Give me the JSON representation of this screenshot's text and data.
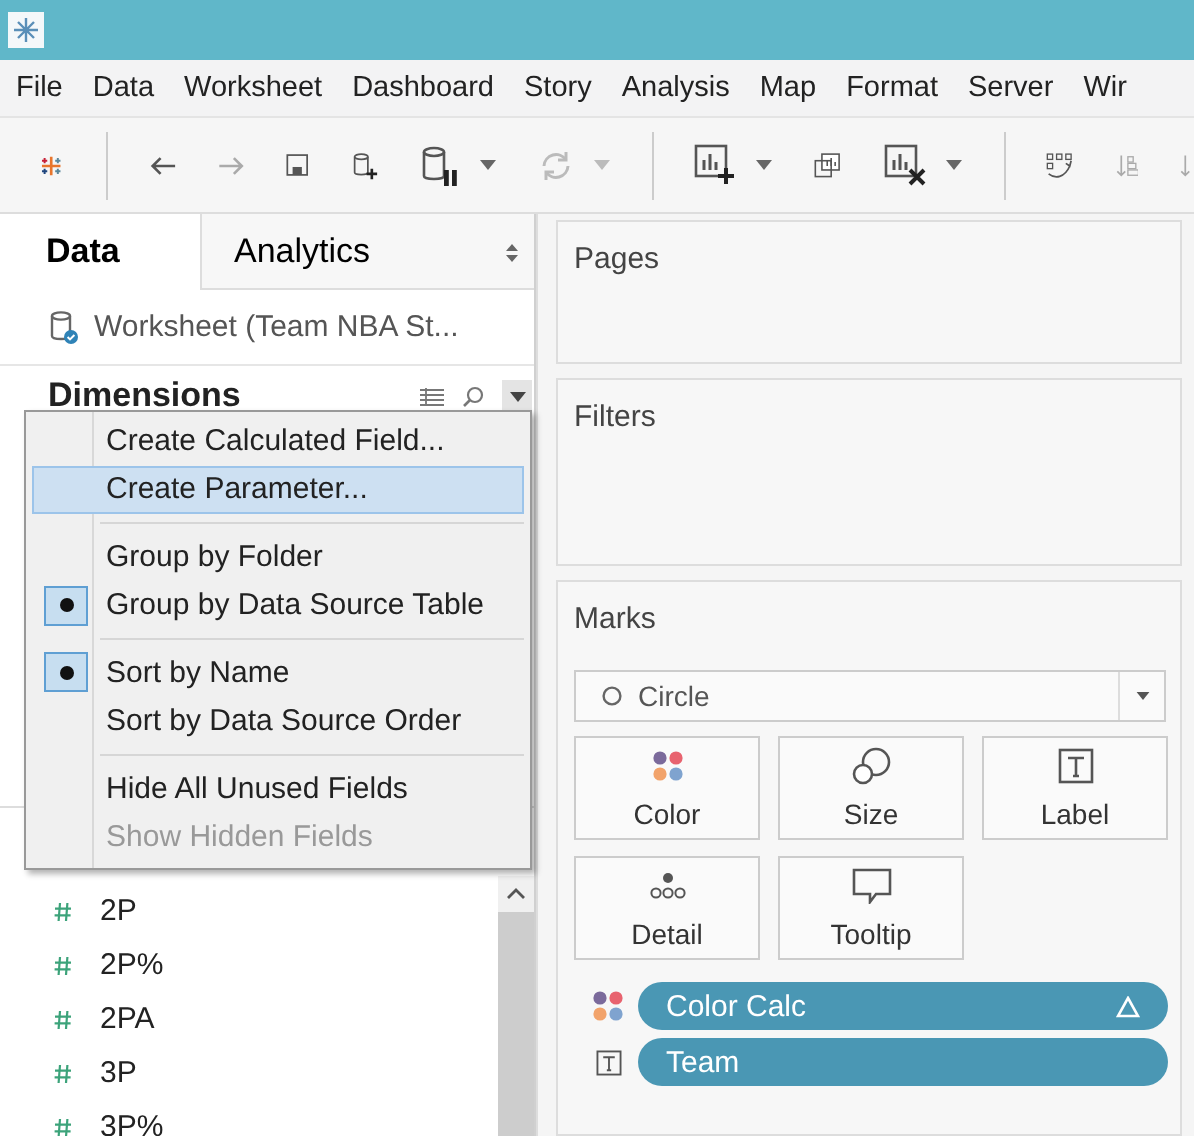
{
  "menubar": [
    "File",
    "Data",
    "Worksheet",
    "Dashboard",
    "Story",
    "Analysis",
    "Map",
    "Format",
    "Server",
    "Wir"
  ],
  "tabs": [
    {
      "label": "Data",
      "selected": true
    },
    {
      "label": "Analytics",
      "selected": false
    }
  ],
  "data_source": "Worksheet (Team NBA St...",
  "section_title": "Dimensions",
  "fields": [
    "2P",
    "2P%",
    "2PA",
    "3P",
    "3P%"
  ],
  "context_menu": [
    [
      {
        "label": "Create Calculated Field...",
        "selected": false,
        "checked": false,
        "disabled": false
      },
      {
        "label": "Create Parameter...",
        "selected": true,
        "checked": false,
        "disabled": false
      }
    ],
    [
      {
        "label": "Group by Folder",
        "selected": false,
        "checked": false,
        "disabled": false
      },
      {
        "label": "Group by Data Source Table",
        "selected": false,
        "checked": true,
        "disabled": false
      }
    ],
    [
      {
        "label": "Sort by Name",
        "selected": false,
        "checked": true,
        "disabled": false
      },
      {
        "label": "Sort by Data Source Order",
        "selected": false,
        "checked": false,
        "disabled": false
      }
    ],
    [
      {
        "label": "Hide All Unused Fields",
        "selected": false,
        "checked": false,
        "disabled": false
      },
      {
        "label": "Show Hidden Fields",
        "selected": false,
        "checked": false,
        "disabled": true
      }
    ]
  ],
  "shelves": [
    "Pages",
    "Filters"
  ],
  "marks": {
    "title": "Marks",
    "mark_type": "Circle",
    "cards": [
      {
        "label": "Color",
        "kind": "color"
      },
      {
        "label": "Size",
        "kind": "size"
      },
      {
        "label": "Label",
        "kind": "label"
      },
      {
        "label": "Detail",
        "kind": "detail"
      },
      {
        "label": "Tooltip",
        "kind": "tooltip"
      }
    ],
    "pills": [
      {
        "label": "Color Calc",
        "kind": "color",
        "calculated": true
      },
      {
        "label": "Team",
        "kind": "label",
        "calculated": false
      }
    ]
  }
}
